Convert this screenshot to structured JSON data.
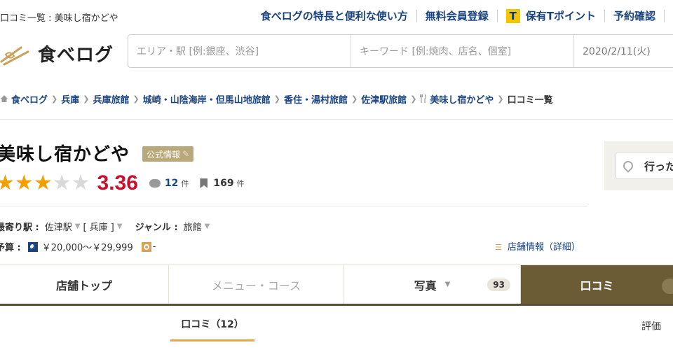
{
  "topbar": {
    "page_label": "口コミ一覧 : 美味し宿かどや",
    "links": {
      "features": "食べログの特長と便利な使い方",
      "register": "無料会員登録",
      "tpoint_icon": "T",
      "tpoint": "保有Tポイント",
      "reservations": "予約確認"
    }
  },
  "logo": {
    "text": "食べログ"
  },
  "search": {
    "area_placeholder": "エリア・駅 [例:銀座、渋谷]",
    "keyword_placeholder": "キーワード [例:焼肉、店名、個室]",
    "date": "2020/2/11(火)"
  },
  "breadcrumb": {
    "items": [
      "食べログ",
      "兵庫",
      "兵庫旅館",
      "城崎・山陰海岸・但馬山地旅館",
      "香住・湯村旅館",
      "佐津駅旅館",
      "美味し宿かどや"
    ],
    "current": "口コミ一覧"
  },
  "restaurant": {
    "name": "美味し宿かどや",
    "official_badge": "公式情報",
    "rating": "3.36",
    "stars_filled": 3,
    "stars_total": 5,
    "review_count": "12",
    "review_unit": "件",
    "bookmark_count": "169",
    "bookmark_unit": "件",
    "station_label": "最寄り駅 :",
    "station": "佐津駅",
    "prefecture": "[ 兵庫 ]",
    "genre_label": "ジャンル :",
    "genre": "旅館",
    "budget_label": "予算 :",
    "budget_dinner": "￥20,000～￥29,999",
    "budget_lunch": "-",
    "shop_info_link": "店舗情報（詳細）"
  },
  "right_box": {
    "button_label": "行った"
  },
  "tabs": {
    "top": "店舗トップ",
    "menu": "メニュー・コース",
    "photos": "写真",
    "photos_count": "93",
    "reviews": "口コミ"
  },
  "subtabs": {
    "reviews": "口コミ（12）",
    "rating": "評価"
  },
  "colors": {
    "link_blue": "#1a4480",
    "rating_red": "#c8102e",
    "star_gold": "#f2a000",
    "active_tab_brown": "#6b5c36",
    "subtab_orange": "#e8a44b"
  }
}
